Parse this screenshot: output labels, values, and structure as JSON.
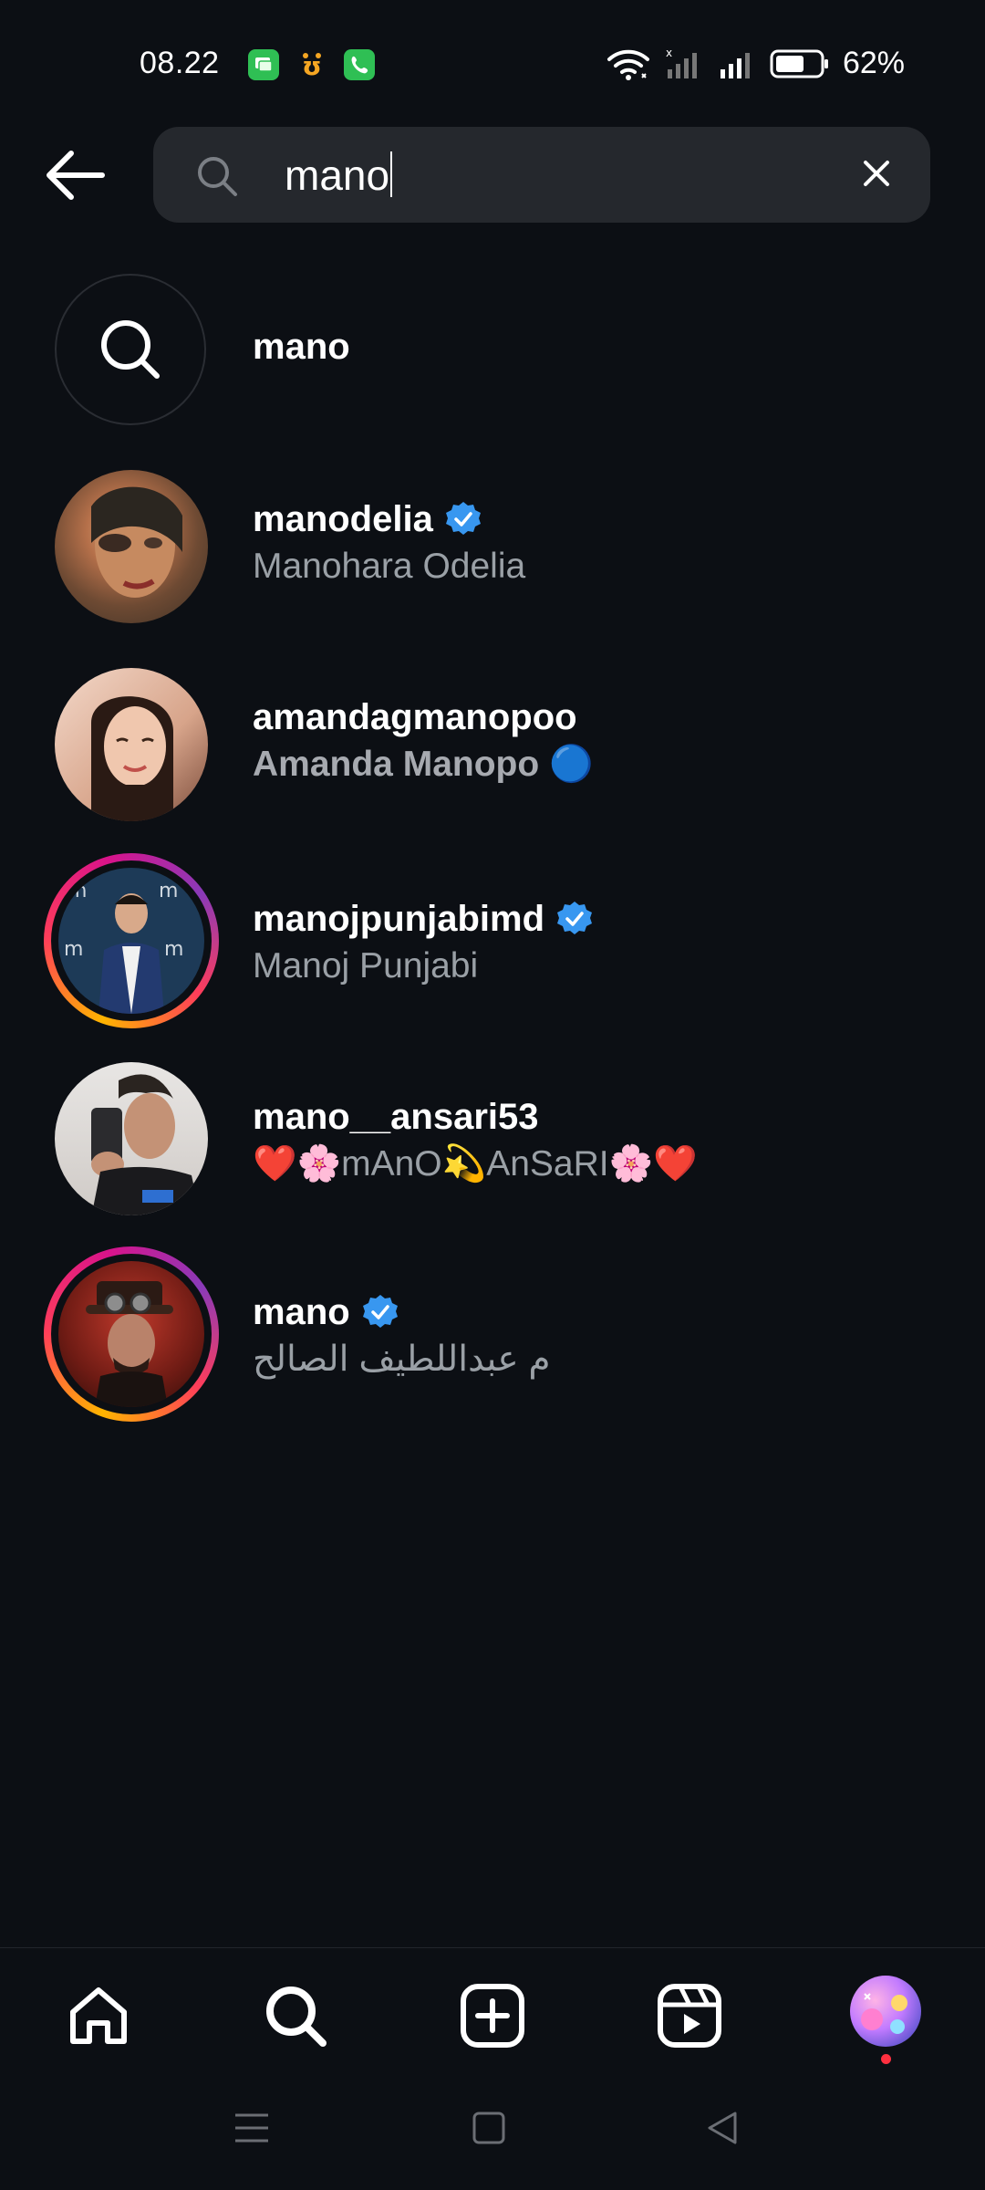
{
  "status_bar": {
    "time": "08.22",
    "battery": "62%"
  },
  "search": {
    "query": "mano"
  },
  "suggestion": {
    "label": "mano"
  },
  "results": [
    {
      "username": "manodelia",
      "fullname": "Manohara Odelia",
      "verified": true
    },
    {
      "username": "amandagmanopoo",
      "fullname": "Amanda Manopo 🔵",
      "verified": false
    },
    {
      "username": "manojpunjabimd",
      "fullname": "Manoj Punjabi",
      "verified": true
    },
    {
      "username": "mano__ansari53",
      "fullname": "❤️🌸mAnO💫AnSaRI🌸❤️",
      "verified": false
    },
    {
      "username": "mano",
      "fullname": "م عبداللطيف الصالح",
      "verified": true
    }
  ],
  "colors": {
    "background": "#0c0f14",
    "search_field": "#25282d",
    "verified_blue": "#3897f0",
    "secondary_text": "#9aa0a6",
    "notification": "#ff3040"
  },
  "icons": {
    "back": "arrow-left-icon",
    "search": "search-icon",
    "clear": "close-icon",
    "verified": "verified-badge-icon",
    "home": "home-icon",
    "explore": "search-icon",
    "create": "plus-square-icon",
    "reels": "reels-icon",
    "profile": "profile-avatar"
  }
}
